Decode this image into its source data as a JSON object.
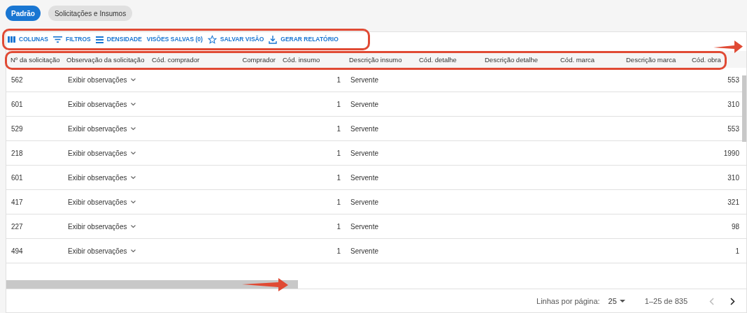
{
  "view_tabs": [
    {
      "label": "Padrão",
      "selected": true
    },
    {
      "label": "Solicitações e Insumos",
      "selected": false
    }
  ],
  "toolbar": [
    {
      "kind": "columns",
      "label": "COLUNAS"
    },
    {
      "kind": "filter",
      "label": "FILTROS"
    },
    {
      "kind": "density",
      "label": "DENSIDADE"
    },
    {
      "kind": "none",
      "label": "VISÕES SALVAS (0)"
    },
    {
      "kind": "star",
      "label": "SALVAR VISÃO"
    },
    {
      "kind": "download",
      "label": "GERAR RELATÓRIO"
    }
  ],
  "table": {
    "columns": [
      "Nº da solicitação",
      "Observação da solicitação",
      "Cód. comprador",
      "Comprador",
      "Cód. insumo",
      "Descrição insumo",
      "Cód. detalhe",
      "Descrição detalhe",
      "Cód. marca",
      "Descrição marca",
      "Cód. obra"
    ],
    "rows": [
      {
        "request_no": "562",
        "observation": "Exibir observações",
        "supply_code": "1",
        "supply_description": "Servente",
        "site_code": "553"
      },
      {
        "request_no": "601",
        "observation": "Exibir observações",
        "supply_code": "1",
        "supply_description": "Servente",
        "site_code": "310"
      },
      {
        "request_no": "529",
        "observation": "Exibir observações",
        "supply_code": "1",
        "supply_description": "Servente",
        "site_code": "553"
      },
      {
        "request_no": "218",
        "observation": "Exibir observações",
        "supply_code": "1",
        "supply_description": "Servente",
        "site_code": "1990"
      },
      {
        "request_no": "601",
        "observation": "Exibir observações",
        "supply_code": "1",
        "supply_description": "Servente",
        "site_code": "310"
      },
      {
        "request_no": "417",
        "observation": "Exibir observações",
        "supply_code": "1",
        "supply_description": "Servente",
        "site_code": "321"
      },
      {
        "request_no": "227",
        "observation": "Exibir observações",
        "supply_code": "1",
        "supply_description": "Servente",
        "site_code": "98"
      },
      {
        "request_no": "494",
        "observation": "Exibir observações",
        "supply_code": "1",
        "supply_description": "Servente",
        "site_code": "1"
      }
    ]
  },
  "pagination": {
    "rows_per_page_label": "Linhas por página:",
    "rows_per_page": "25",
    "range": "1–25 de 835"
  }
}
